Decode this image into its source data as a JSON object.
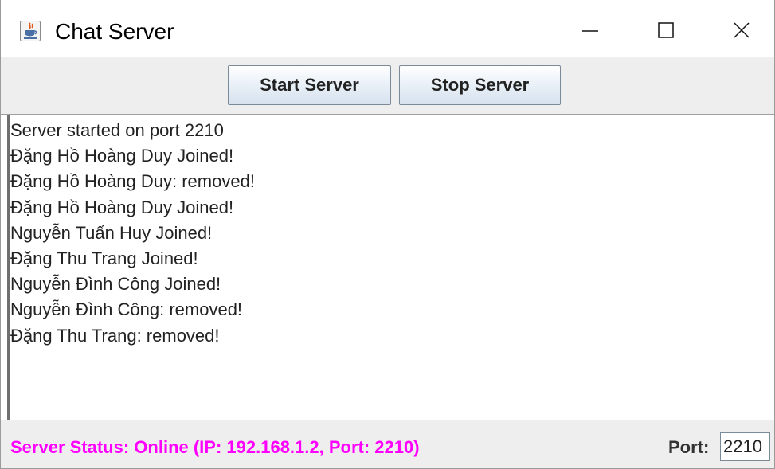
{
  "window": {
    "title": "Chat Server",
    "icon": "java-cup-icon"
  },
  "toolbar": {
    "start_label": "Start Server",
    "stop_label": "Stop Server"
  },
  "log": {
    "lines": [
      "Server started on port 2210",
      "Đặng Hồ Hoàng Duy Joined!",
      "Đặng Hồ Hoàng Duy: removed!",
      "Đặng Hồ Hoàng Duy Joined!",
      "Nguyễn Tuấn Huy Joined!",
      "Đặng Thu Trang Joined!",
      "Nguyễn Đình Công Joined!",
      "Nguyễn Đình Công: removed!",
      "Đặng Thu Trang: removed!"
    ]
  },
  "status": {
    "text": "Server Status: Online (IP: 192.168.1.2, Port: 2210)",
    "color": "#ff00ff"
  },
  "port": {
    "label": "Port:",
    "value": "2210"
  }
}
